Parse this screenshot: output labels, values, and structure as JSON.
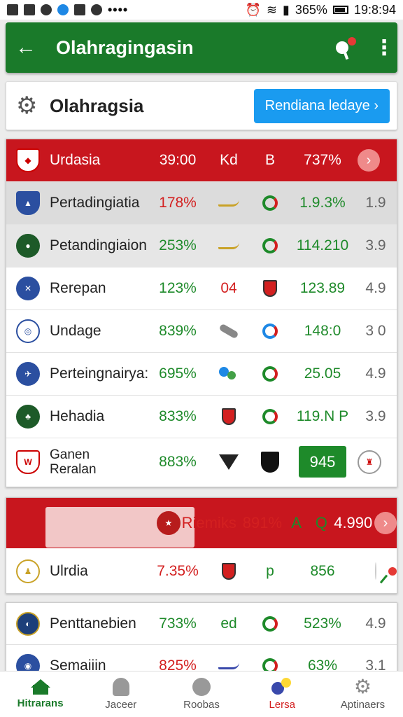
{
  "status_bar": {
    "battery": "365%",
    "time": "19:8:94",
    "dots": "••••"
  },
  "app_bar": {
    "title": "Olahragingasin"
  },
  "sub_header": {
    "title": "Olahragsia",
    "cta": "Rendiana ledaye ›"
  },
  "table": {
    "header": {
      "name": "Urdasia",
      "pct": "39:00",
      "col_k": "Kd",
      "col_b": "B",
      "val": "737%"
    },
    "rows": [
      {
        "name": "Pertadingiatia",
        "pct": "178%",
        "pct_color": "red",
        "val": "1.9.3%",
        "rate": "1.9"
      },
      {
        "name": "Petandingiaion",
        "pct": "253%",
        "pct_color": "green",
        "val": "114.210",
        "rate": "3.9"
      },
      {
        "name": "Rerepan",
        "pct": "123%",
        "pct_color": "green",
        "k_text": "04",
        "val": "123.89",
        "rate": "4.9"
      },
      {
        "name": "Undage",
        "pct": "839%",
        "pct_color": "green",
        "val": "148:0",
        "rate": "3 0"
      },
      {
        "name": "Perteingnairya:",
        "pct": "695%",
        "pct_color": "green",
        "val": "25.05",
        "rate": "4.9"
      },
      {
        "name": "Hehadia",
        "pct": "833%",
        "pct_color": "green",
        "val": "119.N P",
        "rate": "3.9"
      }
    ],
    "last_row": {
      "name_line1": "Ganen",
      "name_line2": "Reralan",
      "pct": "883%",
      "score": "945"
    }
  },
  "featured": {
    "top": {
      "name": "Riemiks",
      "pct": "891%",
      "col_k": "A",
      "col_b": "Q",
      "val": "4.990"
    },
    "bottom": {
      "name": "Ulrdia",
      "pct": "7.35%",
      "col_b": "p",
      "val": "856"
    }
  },
  "list": {
    "rows": [
      {
        "name": "Penttanebien",
        "pct": "733%",
        "col_k": "ed",
        "val": "523%",
        "rate": "4.9"
      },
      {
        "name": "Semaiiin",
        "pct": "825%",
        "val": "63%",
        "rate": "3.1"
      }
    ]
  },
  "bottom_nav": [
    {
      "label": "Hitrarans"
    },
    {
      "label": "Jaceer"
    },
    {
      "label": "Roobas"
    },
    {
      "label": "Lersa"
    },
    {
      "label": "Aptinaers"
    }
  ]
}
